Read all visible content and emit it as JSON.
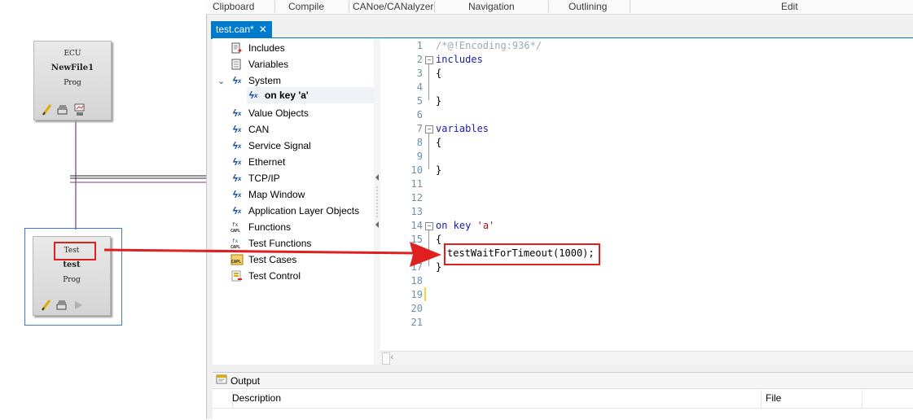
{
  "canvas": {
    "ecu_blocks": [
      {
        "type": "ECU",
        "name": "NewFile1",
        "mode": "Prog"
      },
      {
        "type": "Test",
        "name": "test",
        "mode": "Prog"
      }
    ]
  },
  "ribbon": {
    "groups": [
      "Clipboard",
      "Compile",
      "CANoe/CANalyzer",
      "Navigation",
      "Outlining",
      "Edit"
    ]
  },
  "tabs": [
    {
      "label": "test.can*",
      "close": "✕"
    }
  ],
  "tree": {
    "items": [
      {
        "label": "Includes",
        "icon": "includes-icon"
      },
      {
        "label": "Variables",
        "icon": "variables-icon"
      },
      {
        "label": "System",
        "icon": "event-icon",
        "expander": "⌄"
      },
      {
        "label": "on key 'a'",
        "icon": "event-icon"
      },
      {
        "label": "Value Objects",
        "icon": "event-icon"
      },
      {
        "label": "CAN",
        "icon": "event-icon"
      },
      {
        "label": "Service Signal",
        "icon": "event-icon"
      },
      {
        "label": "Ethernet",
        "icon": "event-icon"
      },
      {
        "label": "TCP/IP",
        "icon": "event-icon"
      },
      {
        "label": "Map Window",
        "icon": "event-icon"
      },
      {
        "label": "Application Layer Objects",
        "icon": "event-icon"
      },
      {
        "label": "Functions",
        "icon": "capl-function-icon"
      },
      {
        "label": "Test Functions",
        "icon": "capl-function-icon"
      },
      {
        "label": "Test Cases",
        "icon": "capl-testcase-icon"
      },
      {
        "label": "Test Control",
        "icon": "test-control-icon"
      }
    ]
  },
  "code": {
    "line_numbers": [
      "1",
      "2",
      "3",
      "4",
      "5",
      "6",
      "7",
      "8",
      "9",
      "10",
      "11",
      "12",
      "13",
      "14",
      "15",
      "16",
      "17",
      "18",
      "19",
      "20",
      "21"
    ],
    "lines": {
      "l1": "/*@!Encoding:936*/",
      "l2": "includes",
      "l3": "{",
      "l5": "}",
      "l7": "variables",
      "l8": "{",
      "l10": "}",
      "l14_kw": "on key",
      "l14_str": "'a'",
      "l15": "{",
      "l16": "testWaitForTimeout(1000);",
      "l17": "}"
    }
  },
  "output": {
    "title": "Output",
    "columns": [
      "Description",
      "File"
    ]
  },
  "colors": {
    "accent": "#007acc",
    "annotation": "#e02020"
  }
}
